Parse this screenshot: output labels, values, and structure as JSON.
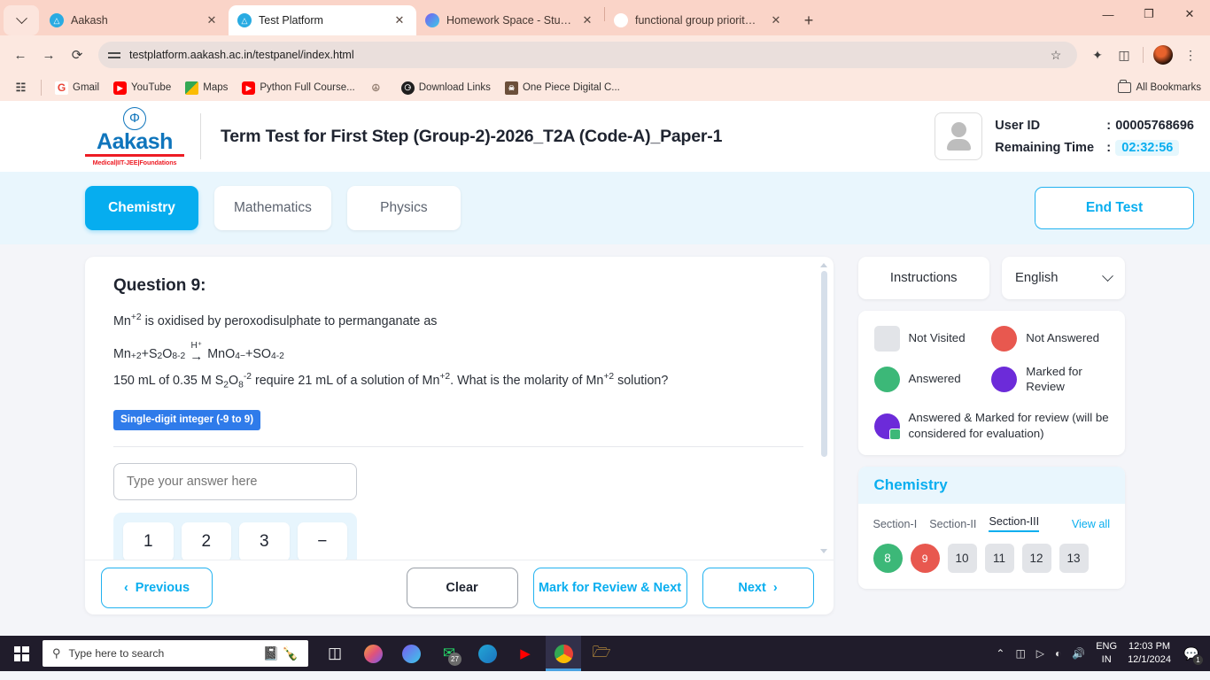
{
  "browser": {
    "tabs": [
      {
        "title": "Aakash",
        "icon": "aakash-favicon",
        "active": false
      },
      {
        "title": "Test Platform",
        "icon": "aakash-favicon",
        "active": true
      },
      {
        "title": "Homework Space - StudyX",
        "icon": "studyx-favicon",
        "active": false
      },
      {
        "title": "functional group priority order",
        "icon": "google-favicon",
        "active": false
      }
    ],
    "new_tab_label": "+",
    "window_controls": {
      "minimize": "—",
      "maximize": "❐",
      "close": "✕"
    },
    "url": "testplatform.aakash.ac.in/testpanel/index.html",
    "nav": {
      "back": "←",
      "forward": "→",
      "reload": "⟳"
    },
    "bookmarks": [
      {
        "label": "Gmail",
        "icon": "gmail-icon",
        "glyph": "G"
      },
      {
        "label": "YouTube",
        "icon": "youtube-icon",
        "glyph": "▶"
      },
      {
        "label": "Maps",
        "icon": "maps-icon",
        "glyph": ""
      },
      {
        "label": "Python Full Course...",
        "icon": "youtube-icon",
        "glyph": "▶"
      },
      {
        "label": "",
        "icon": "temple-icon",
        "glyph": "☨"
      },
      {
        "label": "Download Links",
        "icon": "globe-icon",
        "glyph": "⊕"
      },
      {
        "label": "One Piece Digital C...",
        "icon": "onepiece-icon",
        "glyph": "☠"
      }
    ],
    "all_bookmarks_label": "All Bookmarks"
  },
  "header": {
    "logo_name": "Aakash",
    "logo_tagline": "Medical|IIT-JEE|Foundations",
    "test_title": "Term Test for First Step (Group-2)-2026_T2A (Code-A)_Paper-1",
    "user_id_label": "User ID",
    "user_id_value": "00005768696",
    "remaining_time_label": "Remaining Time",
    "remaining_time_value": "02:32:56",
    "colon": ":"
  },
  "subjects": {
    "tabs": [
      {
        "label": "Chemistry",
        "active": true
      },
      {
        "label": "Mathematics",
        "active": false
      },
      {
        "label": "Physics",
        "active": false
      }
    ],
    "end_test_label": "End Test"
  },
  "question": {
    "title": "Question 9:",
    "line1_prefix": "Mn",
    "line1_sup": "+2",
    "line1_rest": " is oxidised by peroxodisulphate to permanganate as",
    "equation": {
      "reactant1": "Mn",
      "reactant1_sup": "+2",
      "plus1": " + ",
      "reactant2": "S",
      "reactant2_sub1": "2",
      "reactant2_mid": "O",
      "reactant2_sub2": "8",
      "reactant2_sup": "-2",
      "arrow_above": "H⁺",
      "arrow": "→",
      "product1": "MnO",
      "product1_sub": "4",
      "product1_sup": "−",
      "plus2": " + ",
      "product2": "SO",
      "product2_sub": "4",
      "product2_sup": "-2"
    },
    "line3": {
      "a": "150 mL of 0.35 M S",
      "sub1": "2",
      "b": "O",
      "sub2": "8",
      "sup1": "-2",
      "c": " require 21 mL of a solution of Mn",
      "sup2": "+2",
      "d": ". What is the molarity of Mn",
      "sup3": "+2",
      "e": " solution?"
    },
    "answer_type_badge": "Single-digit integer (-9 to 9)",
    "answer_placeholder": "Type your answer here",
    "answer_value": "",
    "keypad_keys": [
      "1",
      "2",
      "3",
      "−",
      "",
      "",
      "",
      ""
    ]
  },
  "footer": {
    "previous_label": "Previous",
    "previous_icon": "‹",
    "clear_label": "Clear",
    "mark_review_label": "Mark for Review & Next",
    "next_label": "Next",
    "next_icon": "›"
  },
  "sidebar": {
    "instructions_label": "Instructions",
    "language_value": "English",
    "legend": [
      {
        "label": "Not Visited",
        "color": "#E2E4E8",
        "shape": "square"
      },
      {
        "label": "Not Answered",
        "color": "#E8584F",
        "shape": "circle"
      },
      {
        "label": "Answered",
        "color": "#3CB878",
        "shape": "circle"
      },
      {
        "label": "Marked for Review",
        "color": "#6C2BD9",
        "shape": "circle"
      }
    ],
    "legend_combo": {
      "label": "Answered & Marked for review (will be considered for evaluation)",
      "color": "#6C2BD9",
      "tick_color": "#3CB878"
    },
    "palette": {
      "subject": "Chemistry",
      "sections": [
        {
          "label": "Section-I",
          "active": false
        },
        {
          "label": "Section-II",
          "active": false
        },
        {
          "label": "Section-III",
          "active": true
        }
      ],
      "view_all_label": "View all",
      "questions": [
        {
          "num": "8",
          "state": "answered"
        },
        {
          "num": "9",
          "state": "notanswered"
        },
        {
          "num": "10",
          "state": "notvisited"
        },
        {
          "num": "11",
          "state": "notvisited"
        },
        {
          "num": "12",
          "state": "notvisited"
        },
        {
          "num": "13",
          "state": "notvisited"
        }
      ]
    }
  },
  "taskbar": {
    "search_placeholder": "Type here to search",
    "apps": [
      {
        "name": "task-view",
        "glyph": "⛶"
      },
      {
        "name": "copilot",
        "glyph": "◆"
      },
      {
        "name": "edge-dev",
        "glyph": "●"
      },
      {
        "name": "whatsapp",
        "glyph": "✆",
        "badge": "27"
      },
      {
        "name": "edge",
        "glyph": "●"
      },
      {
        "name": "youtube",
        "glyph": "▶"
      },
      {
        "name": "chrome",
        "glyph": "◉"
      },
      {
        "name": "file-explorer",
        "glyph": "▬"
      }
    ],
    "tray": {
      "chevron": "⌃",
      "icons": [
        "▣",
        "▭",
        "◴",
        "ᵒ"
      ],
      "language_line1": "ENG",
      "language_line2": "IN",
      "time": "12:03 PM",
      "date": "12/1/2024",
      "notification_count": "1"
    }
  },
  "colors": {
    "accent_blue": "#09AEEF",
    "answered_green": "#3CB878",
    "not_answered_red": "#E8584F",
    "review_purple": "#6C2BD9",
    "badge_blue": "#2F7BEA",
    "logo_blue": "#0F75BC",
    "logo_red": "#ED1C24"
  }
}
